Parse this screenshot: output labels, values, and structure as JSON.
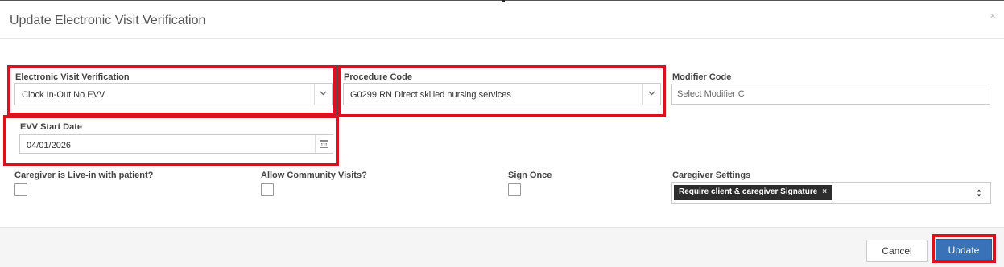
{
  "dialog": {
    "title": "Update Electronic Visit Verification",
    "close_glyph": "×"
  },
  "fields": {
    "evv": {
      "label": "Electronic Visit Verification",
      "value": "Clock In-Out No EVV"
    },
    "procedure_code": {
      "label": "Procedure Code",
      "value": "G0299 RN Direct skilled nursing services"
    },
    "modifier_code": {
      "label": "Modifier Code",
      "placeholder": "Select Modifier C"
    },
    "evv_start_date": {
      "label": "EVV Start Date",
      "value": "04/01/2026"
    },
    "live_in": {
      "label": "Caregiver is Live-in with patient?",
      "checked": false
    },
    "community_visits": {
      "label": "Allow Community Visits?",
      "checked": false
    },
    "sign_once": {
      "label": "Sign Once",
      "checked": false
    },
    "caregiver_settings": {
      "label": "Caregiver Settings",
      "tags": [
        "Require client & caregiver Signature"
      ],
      "tag_remove_glyph": "×"
    }
  },
  "footer": {
    "cancel_label": "Cancel",
    "update_label": "Update"
  },
  "colors": {
    "highlight": "#d8121f",
    "primary_button": "#3a72b8",
    "tag_background": "#2d2d2d"
  },
  "icons": {
    "dropdown": "chevron-down-icon",
    "calendar": "calendar-icon",
    "updown": "sort-arrows-icon",
    "close": "close-icon"
  }
}
